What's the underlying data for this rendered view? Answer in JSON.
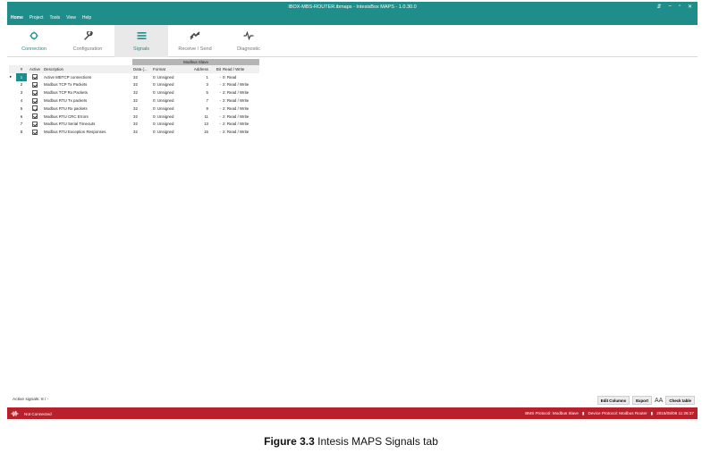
{
  "window": {
    "title": "IBOX-MBS-ROUTER.ibmaps - IntesisBox MAPS - 1.0.30.0"
  },
  "menu": [
    "Home",
    "Project",
    "Tools",
    "View",
    "Help"
  ],
  "window_controls": [
    "pin",
    "minimize",
    "maximize",
    "close"
  ],
  "ribbon": {
    "tabs": [
      {
        "label": "Connection",
        "icon": "connection-icon"
      },
      {
        "label": "Configuration",
        "icon": "wrench-icon"
      },
      {
        "label": "Signals",
        "icon": "list-icon"
      },
      {
        "label": "Receive / Send",
        "icon": "transfer-icon"
      },
      {
        "label": "Diagnostic",
        "icon": "pulse-icon"
      }
    ],
    "selected": "Signals"
  },
  "table": {
    "group_header": "Modbus Slave",
    "headers": [
      "#",
      "Active",
      "Description",
      "Data (...",
      "Format",
      "Address",
      "Bit",
      "Read / Write"
    ],
    "rows": [
      {
        "num": "1",
        "desc": "Active MBTCP connections",
        "data": "32",
        "format": "0: Unsigned",
        "address": "1",
        "bit": "-",
        "rw": "0: Read"
      },
      {
        "num": "2",
        "desc": "Modbus TCP Tx Packets",
        "data": "32",
        "format": "0: Unsigned",
        "address": "3",
        "bit": "-",
        "rw": "2: Read / Write"
      },
      {
        "num": "3",
        "desc": "Modbus TCP Rx Packets",
        "data": "32",
        "format": "0: Unsigned",
        "address": "5",
        "bit": "-",
        "rw": "2: Read / Write"
      },
      {
        "num": "4",
        "desc": "Modbus RTU Tx packets",
        "data": "32",
        "format": "0: Unsigned",
        "address": "7",
        "bit": "-",
        "rw": "2: Read / Write"
      },
      {
        "num": "5",
        "desc": "Modbus RTU Rx packets",
        "data": "32",
        "format": "0: Unsigned",
        "address": "9",
        "bit": "-",
        "rw": "2: Read / Write"
      },
      {
        "num": "6",
        "desc": "Modbus RTU CRC Errors",
        "data": "32",
        "format": "0: Unsigned",
        "address": "11",
        "bit": "-",
        "rw": "2: Read / Write"
      },
      {
        "num": "7",
        "desc": "Modbus RTU Serial Timeouts",
        "data": "32",
        "format": "0: Unsigned",
        "address": "13",
        "bit": "-",
        "rw": "2: Read / Write"
      },
      {
        "num": "8",
        "desc": "Modbus RTU Exception Responses",
        "data": "32",
        "format": "0: Unsigned",
        "address": "15",
        "bit": "-",
        "rw": "2: Read / Write"
      }
    ]
  },
  "footer": {
    "active_signals_label": "Active signals:",
    "active_signals_value": "8 / -",
    "edit_columns": "Edit Columns",
    "export": "Export",
    "font_control": "AA",
    "check_table": "Check table"
  },
  "status": {
    "connection": "Not Connected",
    "bms_protocol": "BMS Protocol: Modbus Slave",
    "device_protocol": "Device Protocol: Modbus Router",
    "datetime": "2016/08/06 11:26:37"
  },
  "caption": {
    "label": "Figure 3.3",
    "text": " Intesis MAPS Signals tab"
  }
}
